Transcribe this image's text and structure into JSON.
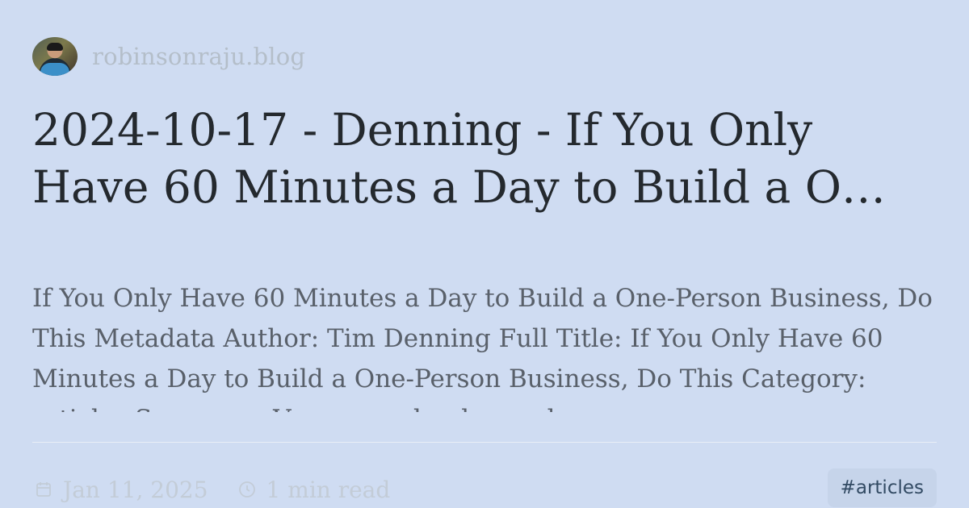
{
  "site": {
    "name": "robinsonraju.blog",
    "avatar_icon": "author-avatar"
  },
  "post": {
    "title": "2024-10-17 - Denning - If You Only Have 60 Minutes a Day to Build a O…",
    "excerpt": "If You Only Have 60 Minutes a Day to Build a One-Person Business, Do This Metadata Author: Tim Denning Full Title: If You Only Have 60 Minutes a Day to Build a One-Person Business, Do This Category: articles Summary: Very, very dumb people are"
  },
  "meta": {
    "date": "Jan 11, 2025",
    "read_time": "1 min read",
    "date_icon": "calendar-icon",
    "time_icon": "clock-icon"
  },
  "tags": [
    "#articles"
  ],
  "colors": {
    "background": "#cfdcf2",
    "title": "#24292e",
    "muted": "#b4bec9",
    "tag_bg": "#c6d4ea",
    "tag_text": "#324a63"
  }
}
